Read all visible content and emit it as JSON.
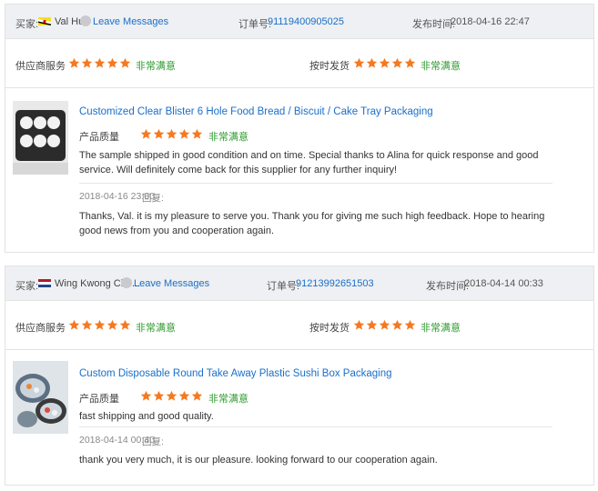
{
  "labels": {
    "buyer": "买家:",
    "leave_messages": "Leave Messages",
    "order_no": "订单号:",
    "published": "发布时间:",
    "supplier_service": "供应商服务",
    "on_time_delivery": "按时发货",
    "product_quality": "产品质量",
    "satisfied": "非常满意",
    "reply": "回复:"
  },
  "colors": {
    "star": "#f5791f",
    "link": "#1a6fc9",
    "satisfied": "#2e9b2e",
    "header_bg": "#eef0f3"
  },
  "reviews": [
    {
      "buyer_name": "Val Hu",
      "flag": "brunei-flag-icon",
      "order_no": "91119400905025",
      "date": "2018-04-16 22:47",
      "supplier_service_stars": 5,
      "delivery_stars": 5,
      "product_title": "Customized Clear Blister 6 Hole Food Bread / Biscuit / Cake Tray Packaging",
      "product_quality_stars": 5,
      "review_text": "The sample shipped in good condition and on time. Special thanks to Alina for quick response and good service. Will definitely come back for this supplier for any further inquiry!",
      "reply_date": "2018-04-16 23:00",
      "reply_text": "Thanks, Val. it is my pleasure to serve you. Thank you for giving me such high feedback. Hope to hearing good news from you and cooperation again."
    },
    {
      "buyer_name": "Wing Kwong Che...",
      "flag": "netherlands-flag-icon",
      "order_no": "91213992651503",
      "date": "2018-04-14 00:33",
      "supplier_service_stars": 5,
      "delivery_stars": 5,
      "product_title": "Custom Disposable Round Take Away Plastic Sushi Box Packaging",
      "product_quality_stars": 5,
      "review_text": "fast shipping and good quality.",
      "reply_date": "2018-04-14 00:40",
      "reply_text": "thank you very much, it is our pleasure. looking forward to our cooperation again."
    }
  ]
}
